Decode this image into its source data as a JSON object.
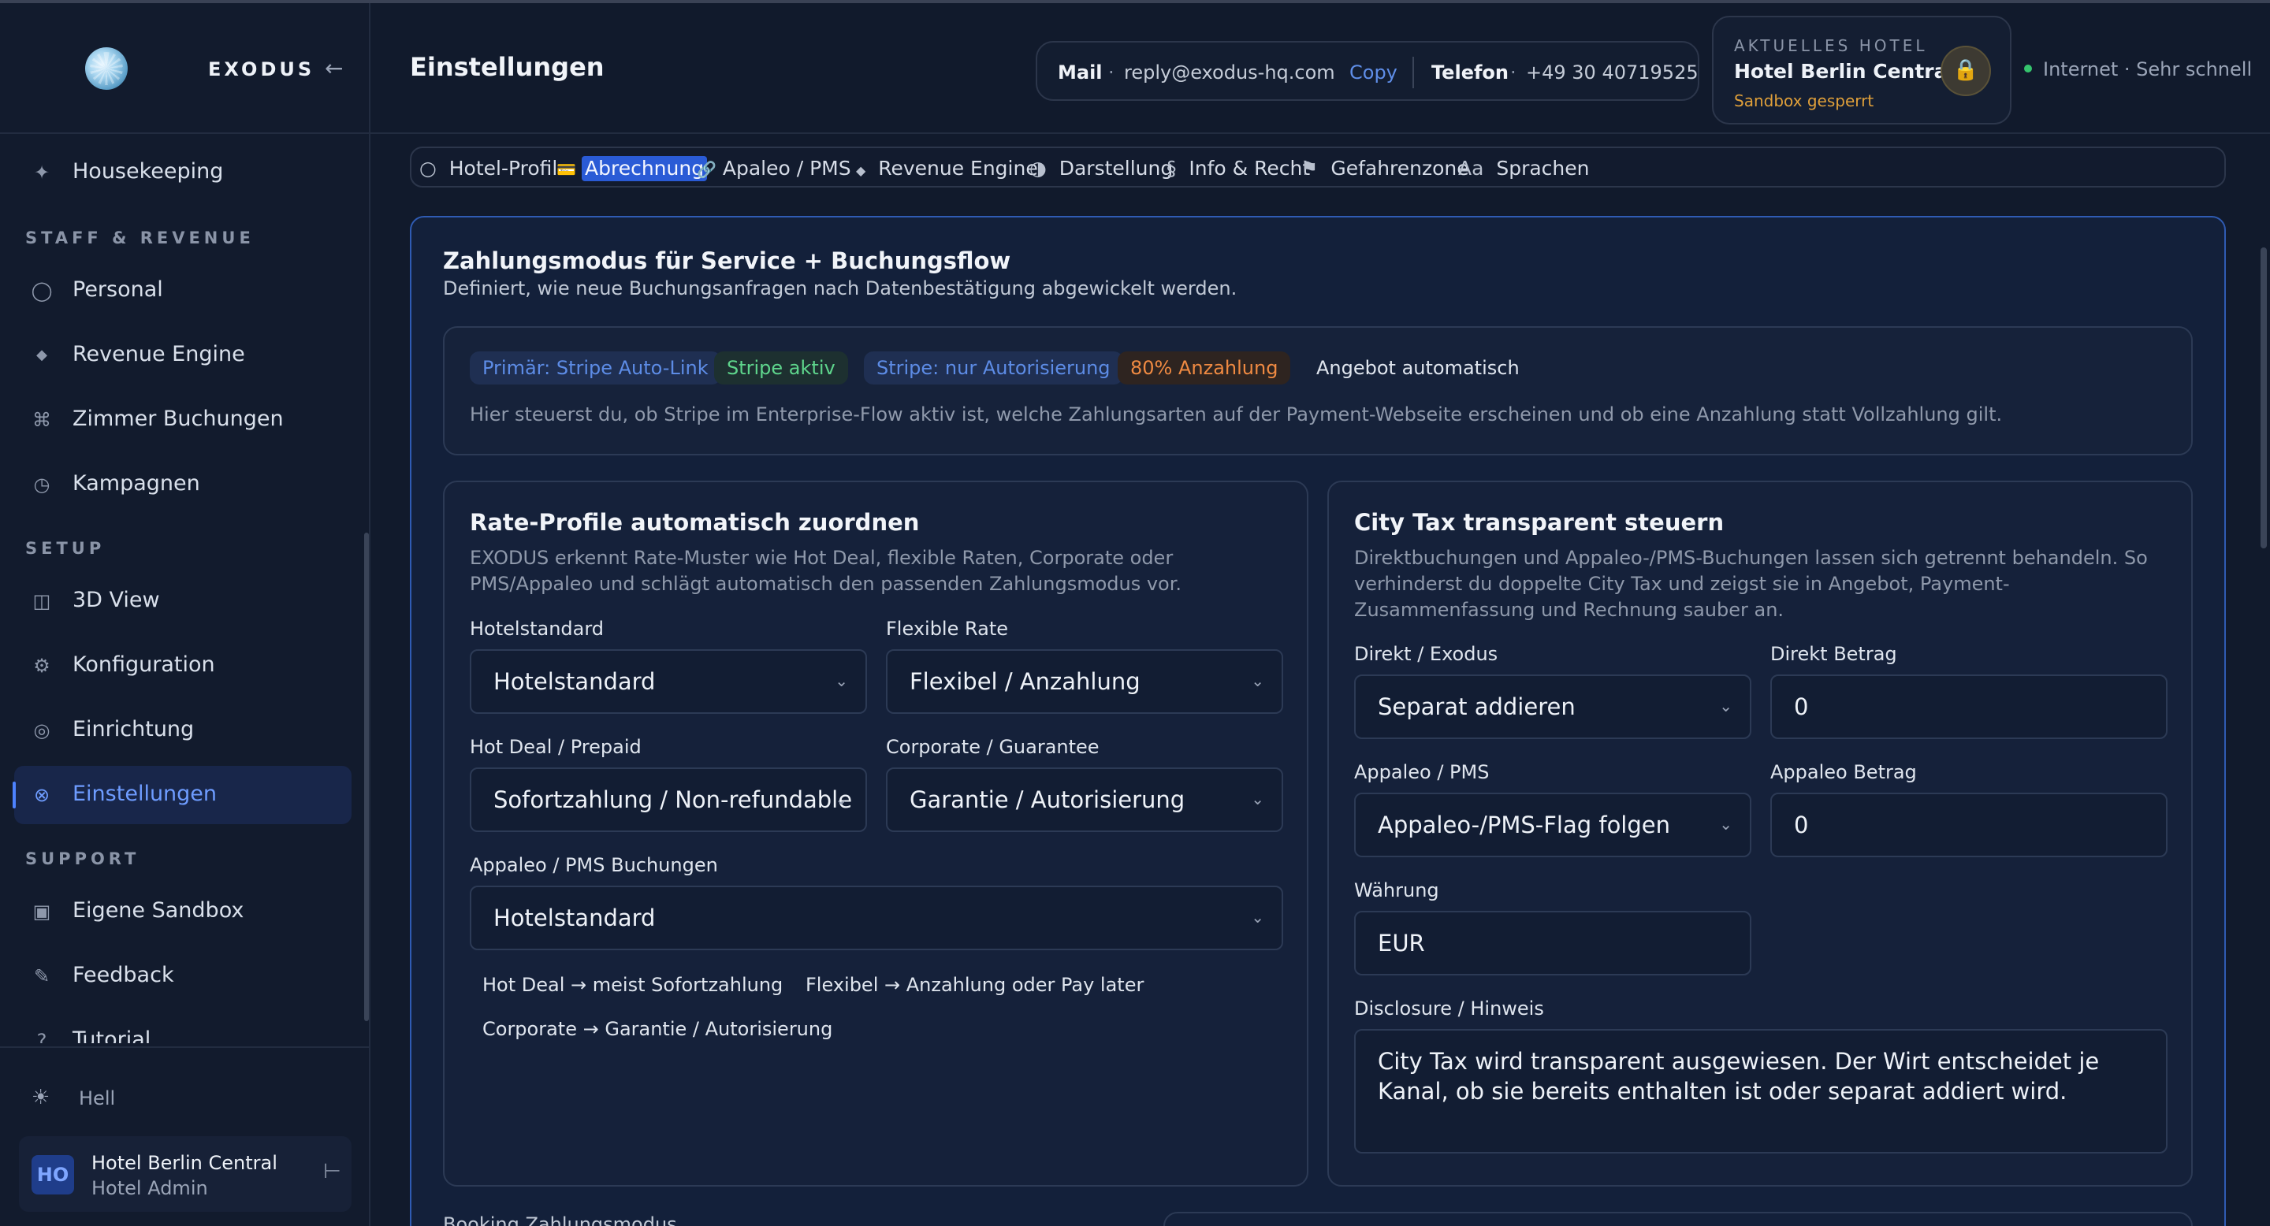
{
  "brand": {
    "name": "EXODUS",
    "collapse_icon": "←"
  },
  "sidebar": {
    "items": [
      {
        "label": "Housekeeping",
        "icon": "✦"
      },
      {
        "label": "Personal",
        "icon": "◯"
      },
      {
        "label": "Revenue Engine",
        "icon": "◆"
      },
      {
        "label": "Zimmer Buchungen",
        "icon": "⌘"
      },
      {
        "label": "Kampagnen",
        "icon": "◷"
      },
      {
        "label": "3D View",
        "icon": "◫"
      },
      {
        "label": "Konfiguration",
        "icon": "⚙"
      },
      {
        "label": "Einrichtung",
        "icon": "◎"
      },
      {
        "label": "Einstellungen",
        "icon": "⊗"
      },
      {
        "label": "Eigene Sandbox",
        "icon": "▣"
      },
      {
        "label": "Feedback",
        "icon": "✎"
      },
      {
        "label": "Tutorial",
        "icon": "?"
      }
    ],
    "sections": {
      "staff_revenue": "STAFF & REVENUE",
      "setup": "SETUP",
      "support": "SUPPORT"
    },
    "theme": {
      "label": "Hell",
      "icon": "☀"
    },
    "user": {
      "initials": "HO",
      "name": "Hotel Berlin Central",
      "role": "Hotel Admin",
      "exit_icon": "⊢"
    }
  },
  "header": {
    "title": "Einstellungen",
    "contact": {
      "mail_label": "Mail",
      "sep": "·",
      "mail_value": "reply@exodus-hq.com",
      "copy_label": "Copy",
      "phone_label": "Telefon",
      "phone_value": "+49 30 40719525"
    },
    "hotel": {
      "kicker": "AKTUELLES HOTEL",
      "name": "Hotel Berlin Central",
      "sandbox": "Sandbox gesperrt",
      "lock_icon": "🔒"
    },
    "network": "Internet · Sehr schnell"
  },
  "tabs": [
    {
      "icon": "○",
      "label": "Hotel-Profil"
    },
    {
      "icon": "💳",
      "label": "Abrechnung"
    },
    {
      "icon": "🔗",
      "label": "Apaleo / PMS"
    },
    {
      "icon": "◆",
      "label": "Revenue Engine"
    },
    {
      "icon": "◑",
      "label": "Darstellung"
    },
    {
      "icon": "§",
      "label": "Info & Recht"
    },
    {
      "icon": "⚑",
      "label": "Gefahrenzone"
    },
    {
      "icon": "Aa",
      "label": "Sprachen"
    }
  ],
  "panel": {
    "title": "Zahlungsmodus für Service + Buchungsflow",
    "subtitle": "Definiert, wie neue Buchungsanfragen nach Datenbestätigung abgewickelt werden.",
    "badges": [
      "Primär: Stripe Auto-Link",
      "Stripe aktiv",
      "Stripe: nur Autorisierung",
      "80% Anzahlung",
      "Angebot automatisch"
    ],
    "summary_text": "Hier steuerst du, ob Stripe im Enterprise-Flow aktiv ist, welche Zahlungsarten auf der Payment-Webseite erscheinen und ob eine Anzahlung statt Vollzahlung gilt.",
    "bottom_peek": "Booking Zahlungsmodus"
  },
  "rate_card": {
    "title": "Rate-Profile automatisch zuordnen",
    "desc": "EXODUS erkennt Rate-Muster wie Hot Deal, flexible Raten, Corporate oder PMS/Appaleo und schlägt automatisch den passenden Zahlungsmodus vor.",
    "fields": {
      "hotelstandard": {
        "label": "Hotelstandard",
        "value": "Hotelstandard"
      },
      "flexible": {
        "label": "Flexible Rate",
        "value": "Flexibel / Anzahlung"
      },
      "hotdeal": {
        "label": "Hot Deal / Prepaid",
        "value": "Sofortzahlung / Non-refundable"
      },
      "corporate": {
        "label": "Corporate / Guarantee",
        "value": "Garantie / Autorisierung"
      },
      "appaleo": {
        "label": "Appaleo / PMS Buchungen",
        "value": "Hotelstandard"
      }
    },
    "hints": [
      "Hot Deal → meist Sofortzahlung",
      "Flexibel → Anzahlung oder Pay later",
      "Corporate → Garantie / Autorisierung"
    ]
  },
  "city_tax_card": {
    "title": "City Tax transparent steuern",
    "desc": "Direktbuchungen und Appaleo-/PMS-Buchungen lassen sich getrennt behandeln. So verhinderst du doppelte City Tax und zeigst sie in Angebot, Payment-Zusammenfassung und Rechnung sauber an.",
    "fields": {
      "direkt": {
        "label": "Direkt / Exodus",
        "value": "Separat addieren"
      },
      "direkt_betrag": {
        "label": "Direkt Betrag",
        "value": "0"
      },
      "appaleo": {
        "label": "Appaleo / PMS",
        "value": "Appaleo-/PMS-Flag folgen"
      },
      "appaleo_betrag": {
        "label": "Appaleo Betrag",
        "value": "0"
      },
      "waehrung": {
        "label": "Währung",
        "value": "EUR"
      },
      "disclosure": {
        "label": "Disclosure / Hinweis",
        "value": "City Tax wird transparent ausgewiesen. Der Wirt entscheidet je Kanal, ob sie bereits enthalten ist oder separat addiert wird."
      }
    }
  },
  "chevron": "⌄",
  "colors": {
    "accent": "#4d82ff",
    "active_tab": "#2a5bd6",
    "success": "#35c46d",
    "warning": "#e0a03a",
    "orange": "#ef8a42"
  }
}
